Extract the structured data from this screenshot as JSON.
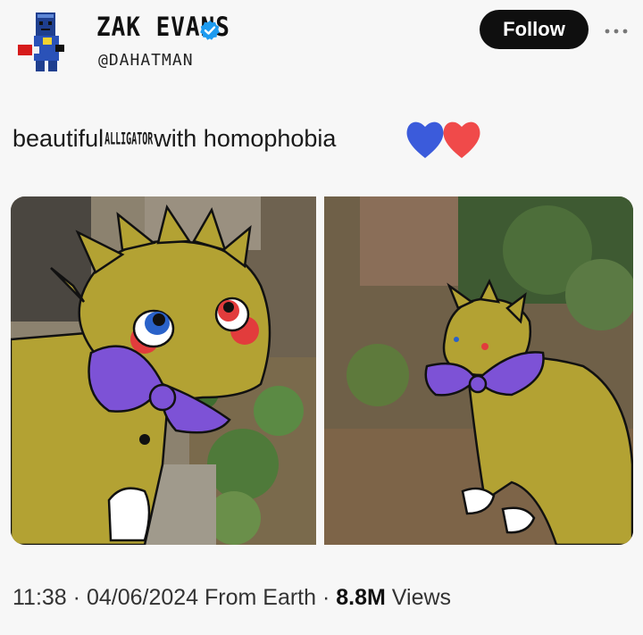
{
  "header": {
    "display_name": "ZAK EVANS",
    "handle": "@DAHATMAN",
    "verified_icon": "verified-badge-icon",
    "follow_label": "Follow",
    "more_icon": "more-icon"
  },
  "tweet": {
    "text_before": "beautiful",
    "text_small": "ALLIGATOR",
    "text_after": "with homophobia",
    "emoji": [
      "blue-heart",
      "red-heart"
    ]
  },
  "media": {
    "count": 2,
    "icons": [
      "photo-left",
      "photo-right"
    ]
  },
  "footer": {
    "time": "11:38",
    "sep1": " · ",
    "date": "04/06/2024",
    "source": " From Earth",
    "sep2": " · ",
    "views": "8.8M",
    "views_label": " Views"
  },
  "colors": {
    "accent": "#1d9bf0",
    "follow_bg": "#0f0f0f",
    "heart_blue": "#3b5bdb",
    "heart_red": "#f04a4a",
    "creature": "#b3a233",
    "bow": "#7d52d6"
  }
}
